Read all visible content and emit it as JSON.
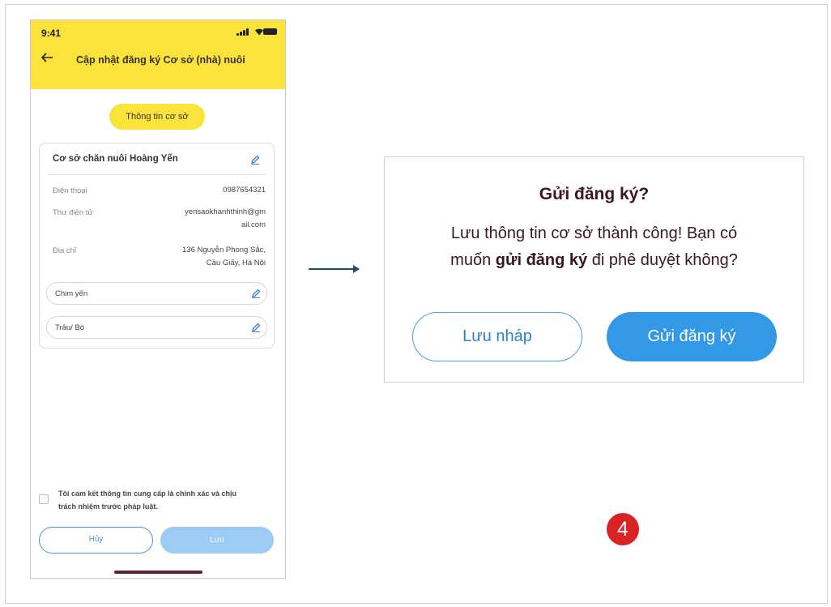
{
  "phone": {
    "status": {
      "time": "9:41"
    },
    "header": {
      "title": "Cập nhật đăng ký Cơ sở (nhà) nuôi"
    },
    "section_pill": "Thông tin cơ sở",
    "facility": {
      "name": "Cơ sở chăn nuôi Hoàng Yến",
      "fields": [
        {
          "label": "Điện thoại",
          "value": "0987654321"
        },
        {
          "label": "Thư điện tử",
          "value_line1": "yensaokhanhthinh@gm",
          "value_line2": "ail.com"
        },
        {
          "label": "Địa chỉ",
          "value_line1": "136 Nguyễn Phong Sắc,",
          "value_line2": "Cầu Giấy, Hà Nội"
        }
      ],
      "animals": [
        "Chim yến",
        "Trâu/ Bò"
      ]
    },
    "commitment_line1": "Tôi cam kết thông tin cung cấp là chính xác và chịu",
    "commitment_line2": "trách nhiệm trước pháp luật.",
    "buttons": {
      "cancel": "Hủy",
      "save": "Lưu"
    }
  },
  "dialog": {
    "title": "Gửi đăng ký?",
    "message_line1": "Lưu thông tin cơ sở thành công! Bạn có",
    "message_pre": "muốn ",
    "message_bold": "gửi đăng ký",
    "message_post": " đi phê duyệt không?",
    "buttons": {
      "draft": "Lưu nháp",
      "submit": "Gửi đăng ký"
    }
  },
  "step_number": "4",
  "colors": {
    "header_yellow": "#fce33b",
    "primary_blue": "#3398e6",
    "disabled_blue": "#9ccbf3",
    "badge_red": "#d92222",
    "dialog_text": "#3a1722"
  },
  "icons": [
    "back-arrow-icon",
    "signal-icon",
    "wifi-icon",
    "battery-icon",
    "edit-pencil-icon",
    "right-arrow-icon"
  ]
}
